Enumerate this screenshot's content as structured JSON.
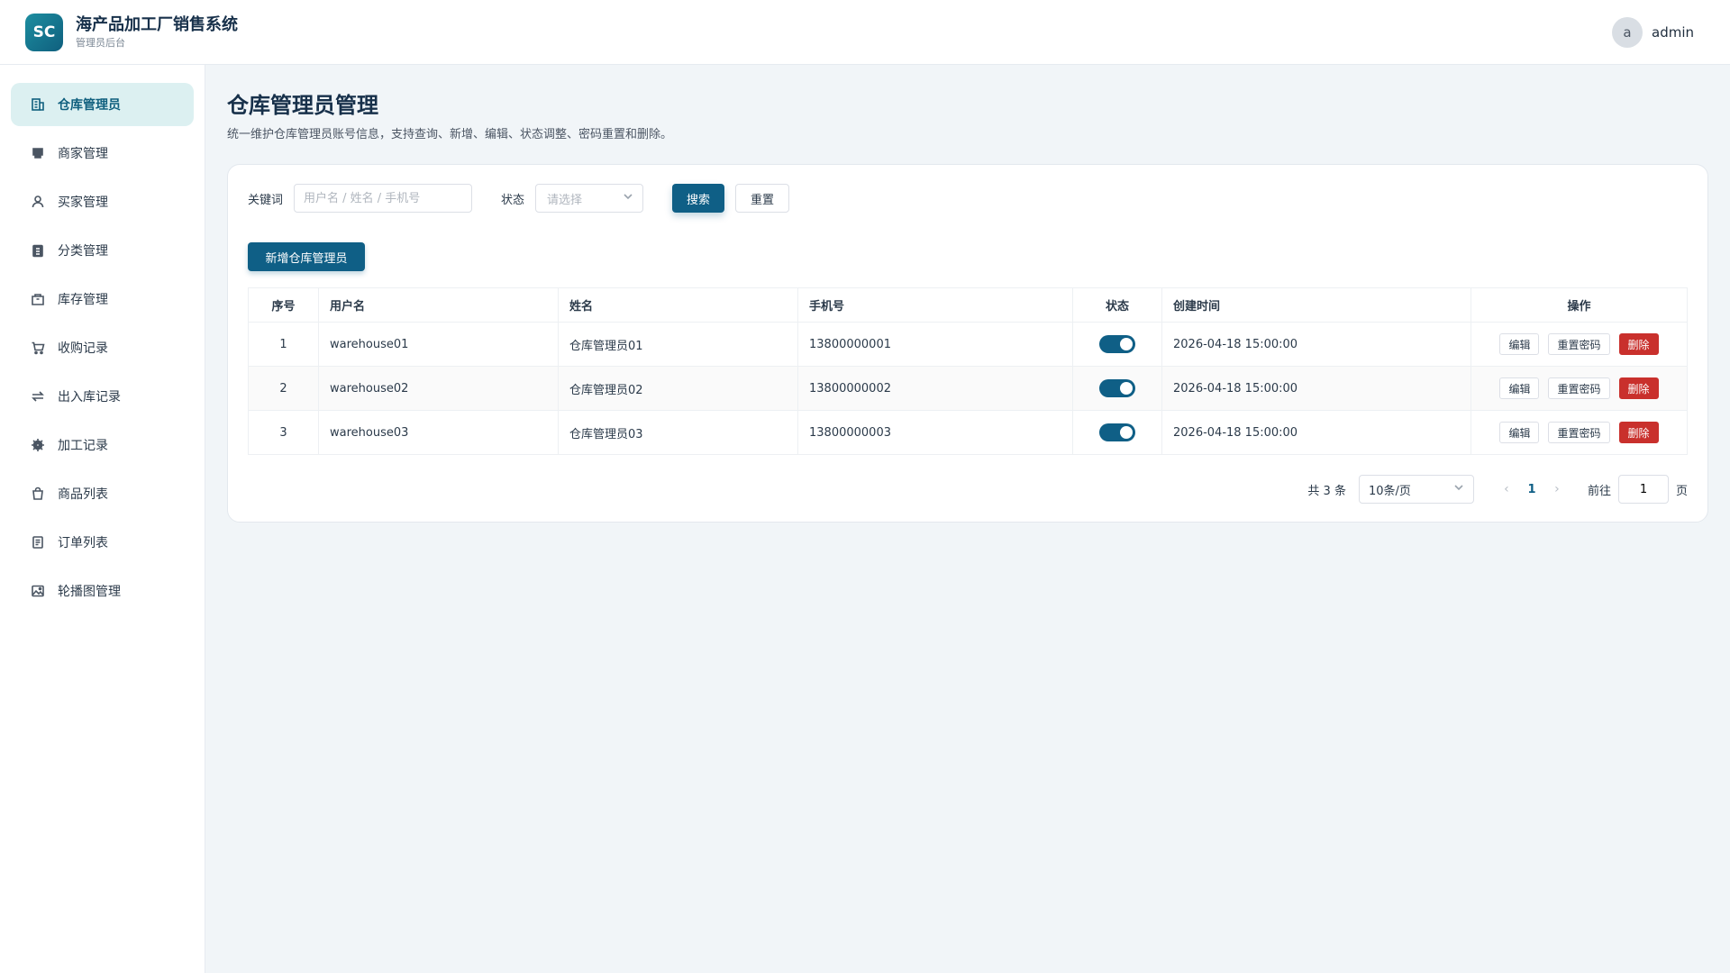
{
  "header": {
    "logo_text": "SC",
    "title": "海产品加工厂销售系统",
    "subtitle": "管理员后台",
    "avatar_letter": "a",
    "username": "admin"
  },
  "sidebar": {
    "items": [
      {
        "label": "仓库管理员",
        "icon": "building-icon",
        "active": true
      },
      {
        "label": "商家管理",
        "icon": "store-icon",
        "active": false
      },
      {
        "label": "买家管理",
        "icon": "user-icon",
        "active": false
      },
      {
        "label": "分类管理",
        "icon": "clipboard-icon",
        "active": false
      },
      {
        "label": "库存管理",
        "icon": "box-icon",
        "active": false
      },
      {
        "label": "收购记录",
        "icon": "cart-icon",
        "active": false
      },
      {
        "label": "出入库记录",
        "icon": "swap-icon",
        "active": false
      },
      {
        "label": "加工记录",
        "icon": "gear-icon",
        "active": false
      },
      {
        "label": "商品列表",
        "icon": "bag-icon",
        "active": false
      },
      {
        "label": "订单列表",
        "icon": "document-icon",
        "active": false
      },
      {
        "label": "轮播图管理",
        "icon": "image-icon",
        "active": false
      }
    ]
  },
  "page": {
    "title": "仓库管理员管理",
    "description": "统一维护仓库管理员账号信息，支持查询、新增、编辑、状态调整、密码重置和删除。"
  },
  "filters": {
    "keyword_label": "关键词",
    "keyword_placeholder": "用户名 / 姓名 / 手机号",
    "keyword_value": "",
    "status_label": "状态",
    "status_placeholder": "请选择",
    "search_label": "搜索",
    "reset_label": "重置"
  },
  "add_button_label": "新增仓库管理员",
  "table": {
    "columns": [
      "序号",
      "用户名",
      "姓名",
      "手机号",
      "状态",
      "创建时间",
      "操作"
    ],
    "rows": [
      {
        "index": "1",
        "username": "warehouse01",
        "name": "仓库管理员01",
        "phone": "13800000001",
        "enabled": true,
        "created": "2026-04-18 15:00:00"
      },
      {
        "index": "2",
        "username": "warehouse02",
        "name": "仓库管理员02",
        "phone": "13800000002",
        "enabled": true,
        "created": "2026-04-18 15:00:00"
      },
      {
        "index": "3",
        "username": "warehouse03",
        "name": "仓库管理员03",
        "phone": "13800000003",
        "enabled": true,
        "created": "2026-04-18 15:00:00"
      }
    ],
    "actions": {
      "edit": "编辑",
      "reset_password": "重置密码",
      "delete": "删除"
    }
  },
  "pagination": {
    "total_text": "共 3 条",
    "page_size": "10条/页",
    "current_page": "1",
    "goto_label": "前往",
    "goto_value": "1",
    "page_suffix": "页"
  },
  "colors": {
    "primary": "#0f5f86",
    "active_nav_bg": "#dcf0f1",
    "danger": "#c9302c",
    "background": "#f1f5f8"
  }
}
